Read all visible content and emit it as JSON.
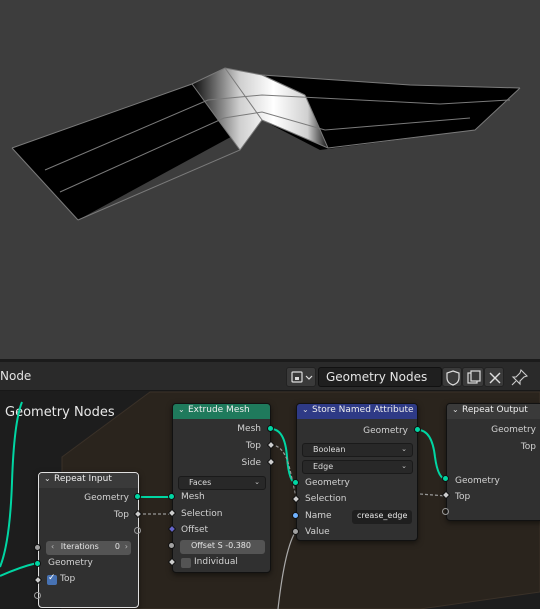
{
  "editor": {
    "header_title": "Node",
    "tree_field": "Geometry Nodes",
    "tree_label": "Geometry Nodes",
    "icons": [
      "editor-type-icon",
      "shield-icon",
      "duplicate-icon",
      "close-icon",
      "pin-icon"
    ]
  },
  "nodes": {
    "repeat_input": {
      "title": "Repeat Input",
      "out_geometry": "Geometry",
      "out_top": "Top",
      "iterations_label": "Iterations",
      "iterations_value": "0",
      "in_geometry": "Geometry",
      "in_top": "Top"
    },
    "extrude_mesh": {
      "title": "Extrude Mesh",
      "out_mesh": "Mesh",
      "out_top": "Top",
      "out_side": "Side",
      "mode": "Faces",
      "in_mesh": "Mesh",
      "in_selection": "Selection",
      "in_offset": "Offset",
      "offset_scale": "Offset S   -0.380",
      "individual": "Individual"
    },
    "store_named_attribute": {
      "title": "Store Named Attribute",
      "out_geometry": "Geometry",
      "data_type": "Boolean",
      "domain": "Edge",
      "in_geometry": "Geometry",
      "in_selection": "Selection",
      "name_label": "Name",
      "name_value": "crease_edge",
      "in_value": "Value"
    },
    "repeat_output": {
      "title": "Repeat Output",
      "out_geometry": "Geometry",
      "out_top": "Top",
      "in_geometry": "Geometry",
      "in_top": "Top"
    }
  },
  "colors": {
    "geometry_socket": "#00d6a3",
    "geometry_header": "#1f7a5c",
    "attribute_header": "#2e3a86",
    "repeat_header": "#3a3a3a"
  }
}
